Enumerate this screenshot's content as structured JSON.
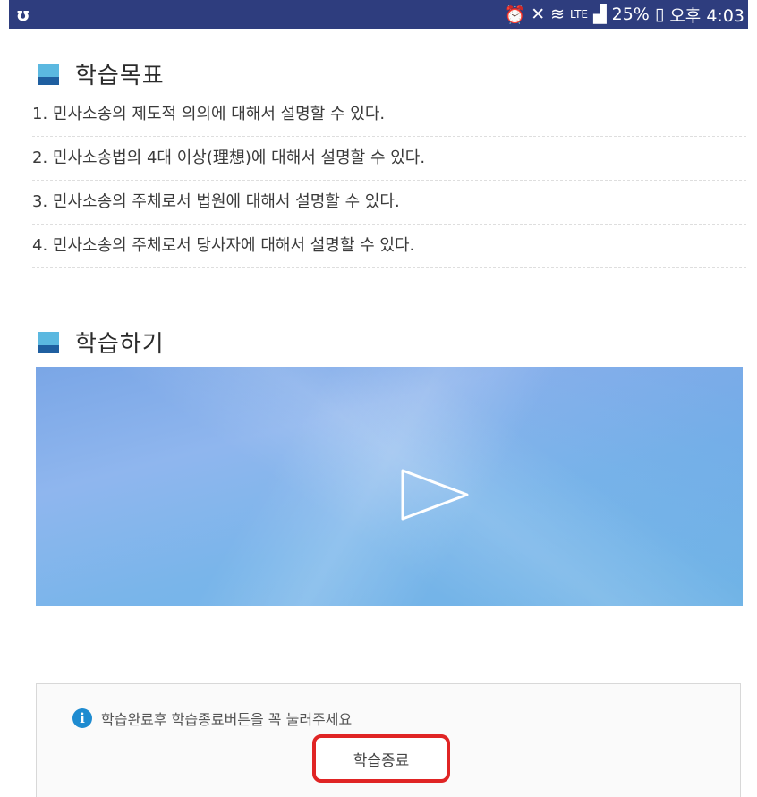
{
  "status_bar": {
    "battery": "25%",
    "time": "오후 4:03",
    "icons": [
      "app-notification-icon",
      "alarm-icon",
      "mute-icon",
      "wifi-icon",
      "lte-icon",
      "signal-icon",
      "battery-icon"
    ]
  },
  "goals_section": {
    "title": "학습목표",
    "items": [
      "1. 민사소송의 제도적 의의에 대해서 설명할 수 있다.",
      "2. 민사소송법의 4대 이상(理想)에 대해서 설명할 수 있다.",
      "3. 민사소송의 주체로서 법원에 대해서 설명할 수 있다.",
      "4. 민사소송의 주체로서 당사자에 대해서 설명할 수 있다."
    ]
  },
  "study_section": {
    "title": "학습하기"
  },
  "notice": {
    "message": "학습완료후 학습종료버튼을 꼭 눌러주세요",
    "end_button_label": "학습종료"
  },
  "colors": {
    "status_bar": "#2e3d7e",
    "marker_light": "#5bb8e0",
    "marker_dark": "#1f5fa0",
    "highlight_border": "#e02424",
    "info_icon": "#1e8bd0"
  }
}
